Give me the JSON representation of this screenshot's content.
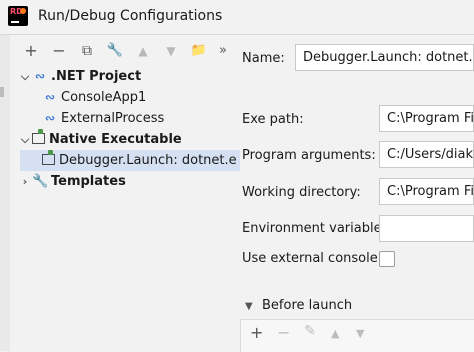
{
  "window": {
    "title": "Run/Debug Configurations",
    "app_icon_text": "RD"
  },
  "tree_toolbar": {
    "add": "+",
    "remove": "−",
    "copy": "⧉",
    "edit_templates": "🔧",
    "move_up": "▲",
    "move_down": "▼",
    "new_folder": "📁",
    "more": "»"
  },
  "tree": {
    "net_project": {
      "label": ".NET Project",
      "icon": "dotnet-icon"
    },
    "console_app": {
      "label": "ConsoleApp1"
    },
    "external_process": {
      "label": "ExternalProcess"
    },
    "native_executable": {
      "label": "Native Executable",
      "icon": "exe-icon"
    },
    "debugger_launch": {
      "label": "Debugger.Launch: dotnet.e"
    },
    "templates": {
      "label": "Templates",
      "icon": "wrench-icon"
    }
  },
  "form": {
    "name_label": "Name:",
    "name_value": "Debugger.Launch: dotnet.exe",
    "exe_path_label": "Exe path:",
    "exe_path_value": "C:\\Program Files",
    "program_args_label": "Program arguments:",
    "program_args_value": "C:/Users/diako/",
    "working_dir_label": "Working directory:",
    "working_dir_value": "C:\\Program Files",
    "env_vars_label": "Environment variables:",
    "env_vars_value": "",
    "external_console_label": "Use external console:",
    "external_console_checked": false
  },
  "before_launch": {
    "label": "Before launch",
    "add": "+",
    "remove": "−",
    "edit": "✎",
    "up": "▲",
    "down": "▼"
  },
  "colors": {
    "accent_blue": "#3a78d8",
    "selection": "#d5e1f2",
    "background": "#f2f2f2"
  }
}
